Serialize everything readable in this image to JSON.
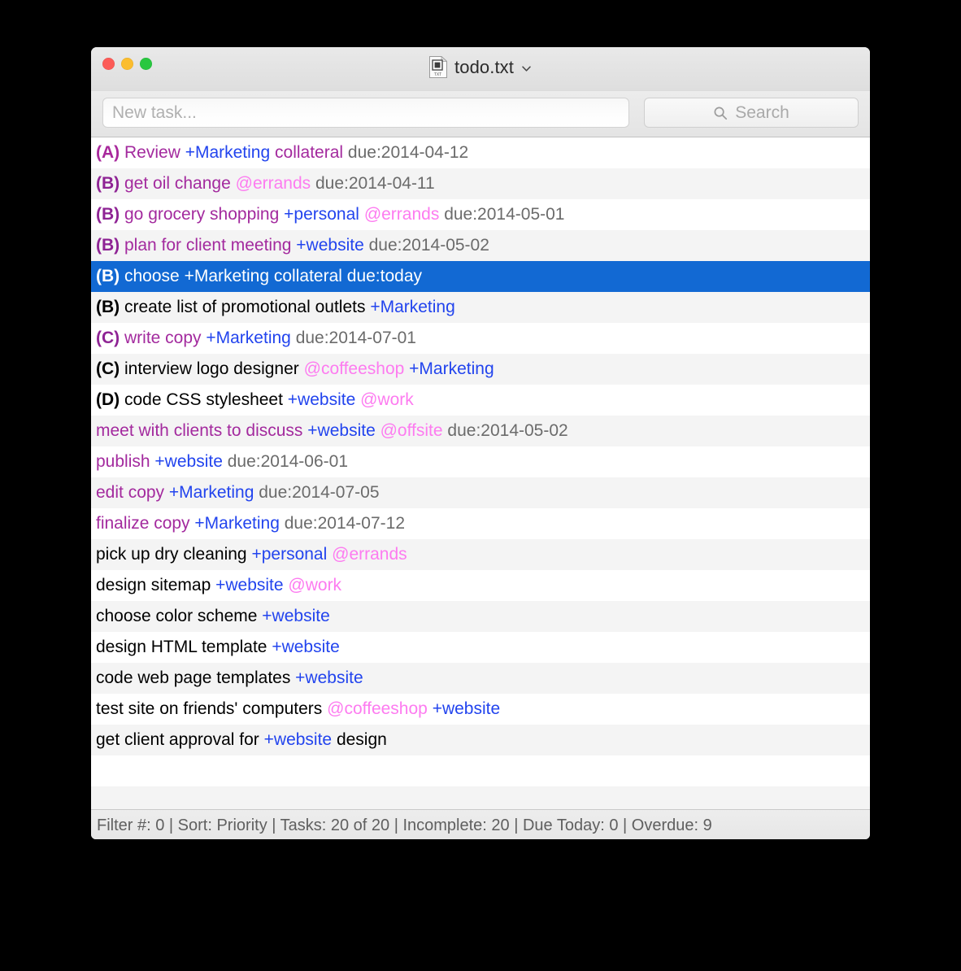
{
  "window": {
    "title": "todo.txt",
    "file_icon": "text-document-icon",
    "icon_label": "TXT",
    "title_chevron": "chevron-down-icon",
    "traffic_lights": [
      {
        "name": "close",
        "color": "#fc5b57"
      },
      {
        "name": "minimize",
        "color": "#fbbd2e"
      },
      {
        "name": "zoom",
        "color": "#28c73f"
      }
    ]
  },
  "toolbar": {
    "new_task_placeholder": "New task...",
    "new_task_value": "",
    "search_placeholder": "Search",
    "search_value": "",
    "search_icon": "magnifying-glass-icon"
  },
  "colors": {
    "selection": "#1269d3",
    "project": "#2244ee",
    "context": "#fd7bf0",
    "due": "#6b6b6b",
    "overdue": "#a32a9e",
    "priority_a": "#a8289c",
    "priority_b": "#8e2394",
    "priority_c": "#8e2394",
    "priority_d": "#000000",
    "row_even": "#ffffff",
    "row_odd": "#f4f4f4"
  },
  "tasks": [
    {
      "selected": false,
      "tokens": [
        {
          "t": "(A)",
          "c": "pri-a",
          "bold": true
        },
        {
          "t": "Review",
          "c": "overdue"
        },
        {
          "t": "+Marketing",
          "c": "project"
        },
        {
          "t": "collateral",
          "c": "overdue"
        },
        {
          "t": "due:2014-04-12",
          "c": "due"
        }
      ]
    },
    {
      "selected": false,
      "tokens": [
        {
          "t": "(B)",
          "c": "pri-b",
          "bold": true
        },
        {
          "t": "get oil change",
          "c": "overdue"
        },
        {
          "t": "@errands",
          "c": "context"
        },
        {
          "t": "due:2014-04-11",
          "c": "due"
        }
      ]
    },
    {
      "selected": false,
      "tokens": [
        {
          "t": "(B)",
          "c": "pri-b",
          "bold": true
        },
        {
          "t": "go grocery shopping",
          "c": "overdue"
        },
        {
          "t": "+personal",
          "c": "project"
        },
        {
          "t": "@errands",
          "c": "context"
        },
        {
          "t": "due:2014-05-01",
          "c": "due"
        }
      ]
    },
    {
      "selected": false,
      "tokens": [
        {
          "t": "(B)",
          "c": "pri-b",
          "bold": true
        },
        {
          "t": "plan for client meeting",
          "c": "overdue"
        },
        {
          "t": "+website",
          "c": "project"
        },
        {
          "t": "due:2014-05-02",
          "c": "due"
        }
      ]
    },
    {
      "selected": true,
      "tokens": [
        {
          "t": "(B)",
          "c": "pri-b",
          "bold": true
        },
        {
          "t": "choose",
          "c": "body"
        },
        {
          "t": "+Marketing",
          "c": "project"
        },
        {
          "t": "collateral",
          "c": "body"
        },
        {
          "t": "due:today",
          "c": "due"
        }
      ]
    },
    {
      "selected": false,
      "tokens": [
        {
          "t": "(B)",
          "c": "pri-d",
          "bold": true
        },
        {
          "t": "create list of promotional outlets",
          "c": "body"
        },
        {
          "t": "+Marketing",
          "c": "project"
        }
      ]
    },
    {
      "selected": false,
      "tokens": [
        {
          "t": "(C)",
          "c": "pri-c",
          "bold": true
        },
        {
          "t": "write copy",
          "c": "overdue"
        },
        {
          "t": "+Marketing",
          "c": "project"
        },
        {
          "t": "due:2014-07-01",
          "c": "due"
        }
      ]
    },
    {
      "selected": false,
      "tokens": [
        {
          "t": "(C)",
          "c": "pri-d",
          "bold": true
        },
        {
          "t": "interview logo designer",
          "c": "body"
        },
        {
          "t": "@coffeeshop",
          "c": "context"
        },
        {
          "t": "+Marketing",
          "c": "project"
        }
      ]
    },
    {
      "selected": false,
      "tokens": [
        {
          "t": "(D)",
          "c": "pri-d",
          "bold": true
        },
        {
          "t": "code CSS stylesheet",
          "c": "body"
        },
        {
          "t": "+website",
          "c": "project"
        },
        {
          "t": "@work",
          "c": "context"
        }
      ]
    },
    {
      "selected": false,
      "tokens": [
        {
          "t": "meet with clients to discuss",
          "c": "overdue"
        },
        {
          "t": "+website",
          "c": "project"
        },
        {
          "t": "@offsite",
          "c": "context"
        },
        {
          "t": "due:2014-05-02",
          "c": "due"
        }
      ]
    },
    {
      "selected": false,
      "tokens": [
        {
          "t": "publish",
          "c": "overdue"
        },
        {
          "t": "+website",
          "c": "project"
        },
        {
          "t": "due:2014-06-01",
          "c": "due"
        }
      ]
    },
    {
      "selected": false,
      "tokens": [
        {
          "t": "edit copy",
          "c": "overdue"
        },
        {
          "t": "+Marketing",
          "c": "project"
        },
        {
          "t": "due:2014-07-05",
          "c": "due"
        }
      ]
    },
    {
      "selected": false,
      "tokens": [
        {
          "t": "finalize copy",
          "c": "overdue"
        },
        {
          "t": "+Marketing",
          "c": "project"
        },
        {
          "t": "due:2014-07-12",
          "c": "due"
        }
      ]
    },
    {
      "selected": false,
      "tokens": [
        {
          "t": "pick up dry cleaning",
          "c": "body"
        },
        {
          "t": "+personal",
          "c": "project"
        },
        {
          "t": "@errands",
          "c": "context"
        }
      ]
    },
    {
      "selected": false,
      "tokens": [
        {
          "t": "design sitemap",
          "c": "body"
        },
        {
          "t": "+website",
          "c": "project"
        },
        {
          "t": "@work",
          "c": "context"
        }
      ]
    },
    {
      "selected": false,
      "tokens": [
        {
          "t": "choose color scheme",
          "c": "body"
        },
        {
          "t": "+website",
          "c": "project"
        }
      ]
    },
    {
      "selected": false,
      "tokens": [
        {
          "t": "design HTML template",
          "c": "body"
        },
        {
          "t": "+website",
          "c": "project"
        }
      ]
    },
    {
      "selected": false,
      "tokens": [
        {
          "t": "code web page templates",
          "c": "body"
        },
        {
          "t": "+website",
          "c": "project"
        }
      ]
    },
    {
      "selected": false,
      "tokens": [
        {
          "t": "test site on friends' computers",
          "c": "body"
        },
        {
          "t": "@coffeeshop",
          "c": "context"
        },
        {
          "t": "+website",
          "c": "project"
        }
      ]
    },
    {
      "selected": false,
      "tokens": [
        {
          "t": "get client approval for",
          "c": "body"
        },
        {
          "t": "+website",
          "c": "project"
        },
        {
          "t": "design",
          "c": "body"
        }
      ]
    }
  ],
  "empty_rows": 2,
  "status_bar": {
    "text": "Filter #: 0 | Sort: Priority | Tasks: 20 of 20 | Incomplete: 20 | Due Today: 0 | Overdue: 9",
    "filter_label": "Filter #:",
    "filter_value": "0",
    "sort_label": "Sort:",
    "sort_value": "Priority",
    "tasks_label": "Tasks:",
    "tasks_value": "20 of 20",
    "incomplete_label": "Incomplete:",
    "incomplete_value": "20",
    "due_today_label": "Due Today:",
    "due_today_value": "0",
    "overdue_label": "Overdue:",
    "overdue_value": "9"
  }
}
